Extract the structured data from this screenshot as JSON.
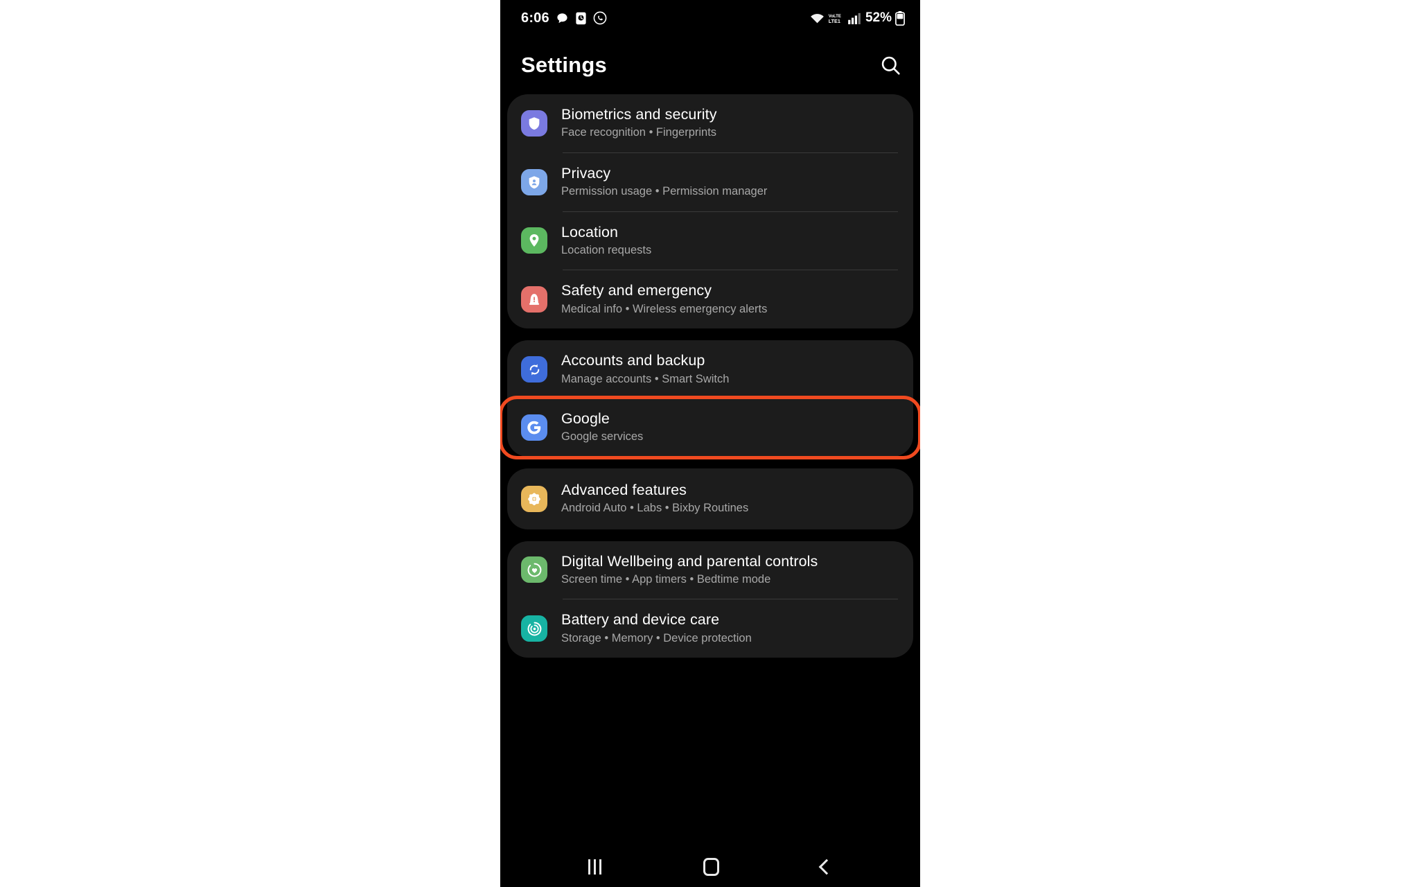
{
  "status_bar": {
    "clock": "6:06",
    "left_icons": [
      "message-bubble-icon",
      "media-photo-icon",
      "whatsapp-icon"
    ],
    "right_icons": [
      "wifi-icon",
      "volte-icon",
      "signal-bars-icon"
    ],
    "volte_label": "VoLTE",
    "battery_percent": "52%"
  },
  "header": {
    "title": "Settings",
    "search_icon": "search-icon"
  },
  "colors": {
    "screen_bg": "#000000",
    "card_bg": "#1c1c1c",
    "title_text": "#ffffff",
    "subtitle_text": "#a8a8a8",
    "divider": "#3a3a3a",
    "highlight": "#f04a20"
  },
  "groups": [
    {
      "name": "security-group",
      "items": [
        {
          "title": "Biometrics and security",
          "subtitle": "Face recognition  •  Fingerprints",
          "icon": "shield-icon",
          "icon_color": "#7a7ae0",
          "highlighted": false
        },
        {
          "title": "Privacy",
          "subtitle": "Permission usage  •  Permission manager",
          "icon": "privacy-shield-person-icon",
          "icon_color": "#7da7e8",
          "highlighted": false
        },
        {
          "title": "Location",
          "subtitle": "Location requests",
          "icon": "location-pin-icon",
          "icon_color": "#5cb860",
          "highlighted": false
        },
        {
          "title": "Safety and emergency",
          "subtitle": "Medical info  •  Wireless emergency alerts",
          "icon": "emergency-siren-icon",
          "icon_color": "#e4706a",
          "highlighted": false
        }
      ]
    },
    {
      "name": "accounts-group",
      "items": [
        {
          "title": "Accounts and backup",
          "subtitle": "Manage accounts  •  Smart Switch",
          "icon": "sync-arrows-icon",
          "icon_color": "#3f6ddb",
          "highlighted": false
        },
        {
          "title": "Google",
          "subtitle": "Google services",
          "icon": "google-g-icon",
          "icon_color": "#5b8def",
          "highlighted": true
        }
      ]
    },
    {
      "name": "advanced-group",
      "items": [
        {
          "title": "Advanced features",
          "subtitle": "Android Auto  •  Labs  •  Bixby Routines",
          "icon": "gear-star-icon",
          "icon_color": "#e8b75a",
          "highlighted": false
        }
      ]
    },
    {
      "name": "wellbeing-group",
      "items": [
        {
          "title": "Digital Wellbeing and parental controls",
          "subtitle": "Screen time  •  App timers  •  Bedtime mode",
          "icon": "wellbeing-heart-icon",
          "icon_color": "#6cb96c",
          "highlighted": false
        },
        {
          "title": "Battery and device care",
          "subtitle": "Storage  •  Memory  •  Device protection",
          "icon": "device-care-icon",
          "icon_color": "#17b3a3",
          "highlighted": false
        }
      ]
    }
  ],
  "nav_bar": {
    "recents_label": "recents-icon",
    "home_label": "home-icon",
    "back_label": "back-icon"
  }
}
